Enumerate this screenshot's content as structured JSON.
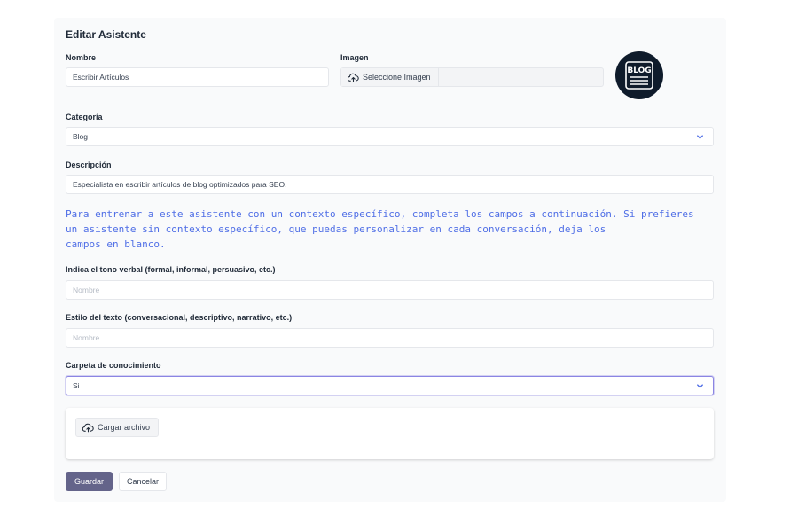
{
  "form": {
    "title": "Editar Asistente",
    "nombre_label": "Nombre",
    "nombre_value": "Escribir Artículos",
    "imagen_label": "Imagen",
    "imagen_button": "Seleccione Imagen",
    "logo_text": "BLOG",
    "categoria_label": "Categoría",
    "categoria_value": "Blog",
    "descripcion_label": "Descripción",
    "descripcion_value": "Especialista en escribir artículos de blog optimizados para SEO.",
    "info_line1": "Para entrenar a este asistente con un contexto específico, completa los campos a continuación. Si prefieres",
    "info_line2": "un asistente sin contexto específico, que puedas personalizar en cada conversación, deja los",
    "info_line3": "campos en blanco.",
    "tono_label": "Indica el tono verbal (formal, informal, persuasivo, etc.)",
    "tono_placeholder": "Nombre",
    "estilo_label": "Estilo del texto (conversacional, descriptivo, narrativo, etc.)",
    "estilo_placeholder": "Nombre",
    "carpeta_label": "Carpeta de conocimiento",
    "carpeta_value": "Si",
    "upload_button": "Cargar archivo",
    "save_button": "Guardar",
    "cancel_button": "Cancelar"
  },
  "icons": {
    "upload": "cloud-upload-icon",
    "chevron": "chevron-down-icon"
  },
  "colors": {
    "accent_text": "#4f6ee6",
    "primary_button": "#64648a",
    "focus_border": "#8b85e3",
    "logo_background": "#0f1b2b"
  }
}
